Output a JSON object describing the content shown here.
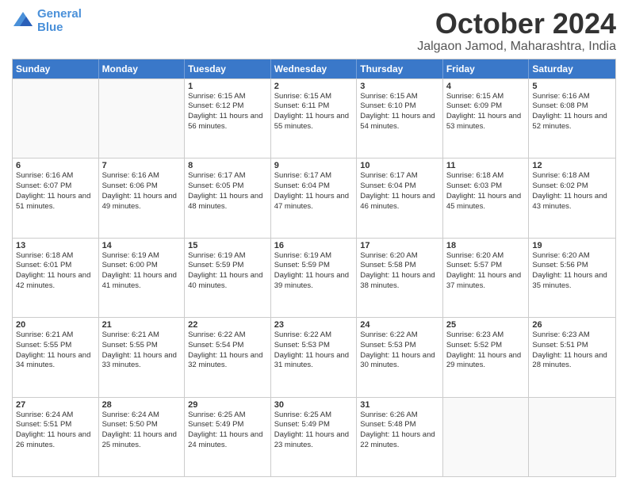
{
  "header": {
    "logo_line1": "General",
    "logo_line2": "Blue",
    "title": "October 2024",
    "subtitle": "Jalgaon Jamod, Maharashtra, India"
  },
  "days": [
    "Sunday",
    "Monday",
    "Tuesday",
    "Wednesday",
    "Thursday",
    "Friday",
    "Saturday"
  ],
  "rows": [
    [
      {
        "day": "",
        "sunrise": "",
        "sunset": "",
        "daylight": ""
      },
      {
        "day": "",
        "sunrise": "",
        "sunset": "",
        "daylight": ""
      },
      {
        "day": "1",
        "sunrise": "Sunrise: 6:15 AM",
        "sunset": "Sunset: 6:12 PM",
        "daylight": "Daylight: 11 hours and 56 minutes."
      },
      {
        "day": "2",
        "sunrise": "Sunrise: 6:15 AM",
        "sunset": "Sunset: 6:11 PM",
        "daylight": "Daylight: 11 hours and 55 minutes."
      },
      {
        "day": "3",
        "sunrise": "Sunrise: 6:15 AM",
        "sunset": "Sunset: 6:10 PM",
        "daylight": "Daylight: 11 hours and 54 minutes."
      },
      {
        "day": "4",
        "sunrise": "Sunrise: 6:15 AM",
        "sunset": "Sunset: 6:09 PM",
        "daylight": "Daylight: 11 hours and 53 minutes."
      },
      {
        "day": "5",
        "sunrise": "Sunrise: 6:16 AM",
        "sunset": "Sunset: 6:08 PM",
        "daylight": "Daylight: 11 hours and 52 minutes."
      }
    ],
    [
      {
        "day": "6",
        "sunrise": "Sunrise: 6:16 AM",
        "sunset": "Sunset: 6:07 PM",
        "daylight": "Daylight: 11 hours and 51 minutes."
      },
      {
        "day": "7",
        "sunrise": "Sunrise: 6:16 AM",
        "sunset": "Sunset: 6:06 PM",
        "daylight": "Daylight: 11 hours and 49 minutes."
      },
      {
        "day": "8",
        "sunrise": "Sunrise: 6:17 AM",
        "sunset": "Sunset: 6:05 PM",
        "daylight": "Daylight: 11 hours and 48 minutes."
      },
      {
        "day": "9",
        "sunrise": "Sunrise: 6:17 AM",
        "sunset": "Sunset: 6:04 PM",
        "daylight": "Daylight: 11 hours and 47 minutes."
      },
      {
        "day": "10",
        "sunrise": "Sunrise: 6:17 AM",
        "sunset": "Sunset: 6:04 PM",
        "daylight": "Daylight: 11 hours and 46 minutes."
      },
      {
        "day": "11",
        "sunrise": "Sunrise: 6:18 AM",
        "sunset": "Sunset: 6:03 PM",
        "daylight": "Daylight: 11 hours and 45 minutes."
      },
      {
        "day": "12",
        "sunrise": "Sunrise: 6:18 AM",
        "sunset": "Sunset: 6:02 PM",
        "daylight": "Daylight: 11 hours and 43 minutes."
      }
    ],
    [
      {
        "day": "13",
        "sunrise": "Sunrise: 6:18 AM",
        "sunset": "Sunset: 6:01 PM",
        "daylight": "Daylight: 11 hours and 42 minutes."
      },
      {
        "day": "14",
        "sunrise": "Sunrise: 6:19 AM",
        "sunset": "Sunset: 6:00 PM",
        "daylight": "Daylight: 11 hours and 41 minutes."
      },
      {
        "day": "15",
        "sunrise": "Sunrise: 6:19 AM",
        "sunset": "Sunset: 5:59 PM",
        "daylight": "Daylight: 11 hours and 40 minutes."
      },
      {
        "day": "16",
        "sunrise": "Sunrise: 6:19 AM",
        "sunset": "Sunset: 5:59 PM",
        "daylight": "Daylight: 11 hours and 39 minutes."
      },
      {
        "day": "17",
        "sunrise": "Sunrise: 6:20 AM",
        "sunset": "Sunset: 5:58 PM",
        "daylight": "Daylight: 11 hours and 38 minutes."
      },
      {
        "day": "18",
        "sunrise": "Sunrise: 6:20 AM",
        "sunset": "Sunset: 5:57 PM",
        "daylight": "Daylight: 11 hours and 37 minutes."
      },
      {
        "day": "19",
        "sunrise": "Sunrise: 6:20 AM",
        "sunset": "Sunset: 5:56 PM",
        "daylight": "Daylight: 11 hours and 35 minutes."
      }
    ],
    [
      {
        "day": "20",
        "sunrise": "Sunrise: 6:21 AM",
        "sunset": "Sunset: 5:55 PM",
        "daylight": "Daylight: 11 hours and 34 minutes."
      },
      {
        "day": "21",
        "sunrise": "Sunrise: 6:21 AM",
        "sunset": "Sunset: 5:55 PM",
        "daylight": "Daylight: 11 hours and 33 minutes."
      },
      {
        "day": "22",
        "sunrise": "Sunrise: 6:22 AM",
        "sunset": "Sunset: 5:54 PM",
        "daylight": "Daylight: 11 hours and 32 minutes."
      },
      {
        "day": "23",
        "sunrise": "Sunrise: 6:22 AM",
        "sunset": "Sunset: 5:53 PM",
        "daylight": "Daylight: 11 hours and 31 minutes."
      },
      {
        "day": "24",
        "sunrise": "Sunrise: 6:22 AM",
        "sunset": "Sunset: 5:53 PM",
        "daylight": "Daylight: 11 hours and 30 minutes."
      },
      {
        "day": "25",
        "sunrise": "Sunrise: 6:23 AM",
        "sunset": "Sunset: 5:52 PM",
        "daylight": "Daylight: 11 hours and 29 minutes."
      },
      {
        "day": "26",
        "sunrise": "Sunrise: 6:23 AM",
        "sunset": "Sunset: 5:51 PM",
        "daylight": "Daylight: 11 hours and 28 minutes."
      }
    ],
    [
      {
        "day": "27",
        "sunrise": "Sunrise: 6:24 AM",
        "sunset": "Sunset: 5:51 PM",
        "daylight": "Daylight: 11 hours and 26 minutes."
      },
      {
        "day": "28",
        "sunrise": "Sunrise: 6:24 AM",
        "sunset": "Sunset: 5:50 PM",
        "daylight": "Daylight: 11 hours and 25 minutes."
      },
      {
        "day": "29",
        "sunrise": "Sunrise: 6:25 AM",
        "sunset": "Sunset: 5:49 PM",
        "daylight": "Daylight: 11 hours and 24 minutes."
      },
      {
        "day": "30",
        "sunrise": "Sunrise: 6:25 AM",
        "sunset": "Sunset: 5:49 PM",
        "daylight": "Daylight: 11 hours and 23 minutes."
      },
      {
        "day": "31",
        "sunrise": "Sunrise: 6:26 AM",
        "sunset": "Sunset: 5:48 PM",
        "daylight": "Daylight: 11 hours and 22 minutes."
      },
      {
        "day": "",
        "sunrise": "",
        "sunset": "",
        "daylight": ""
      },
      {
        "day": "",
        "sunrise": "",
        "sunset": "",
        "daylight": ""
      }
    ]
  ]
}
